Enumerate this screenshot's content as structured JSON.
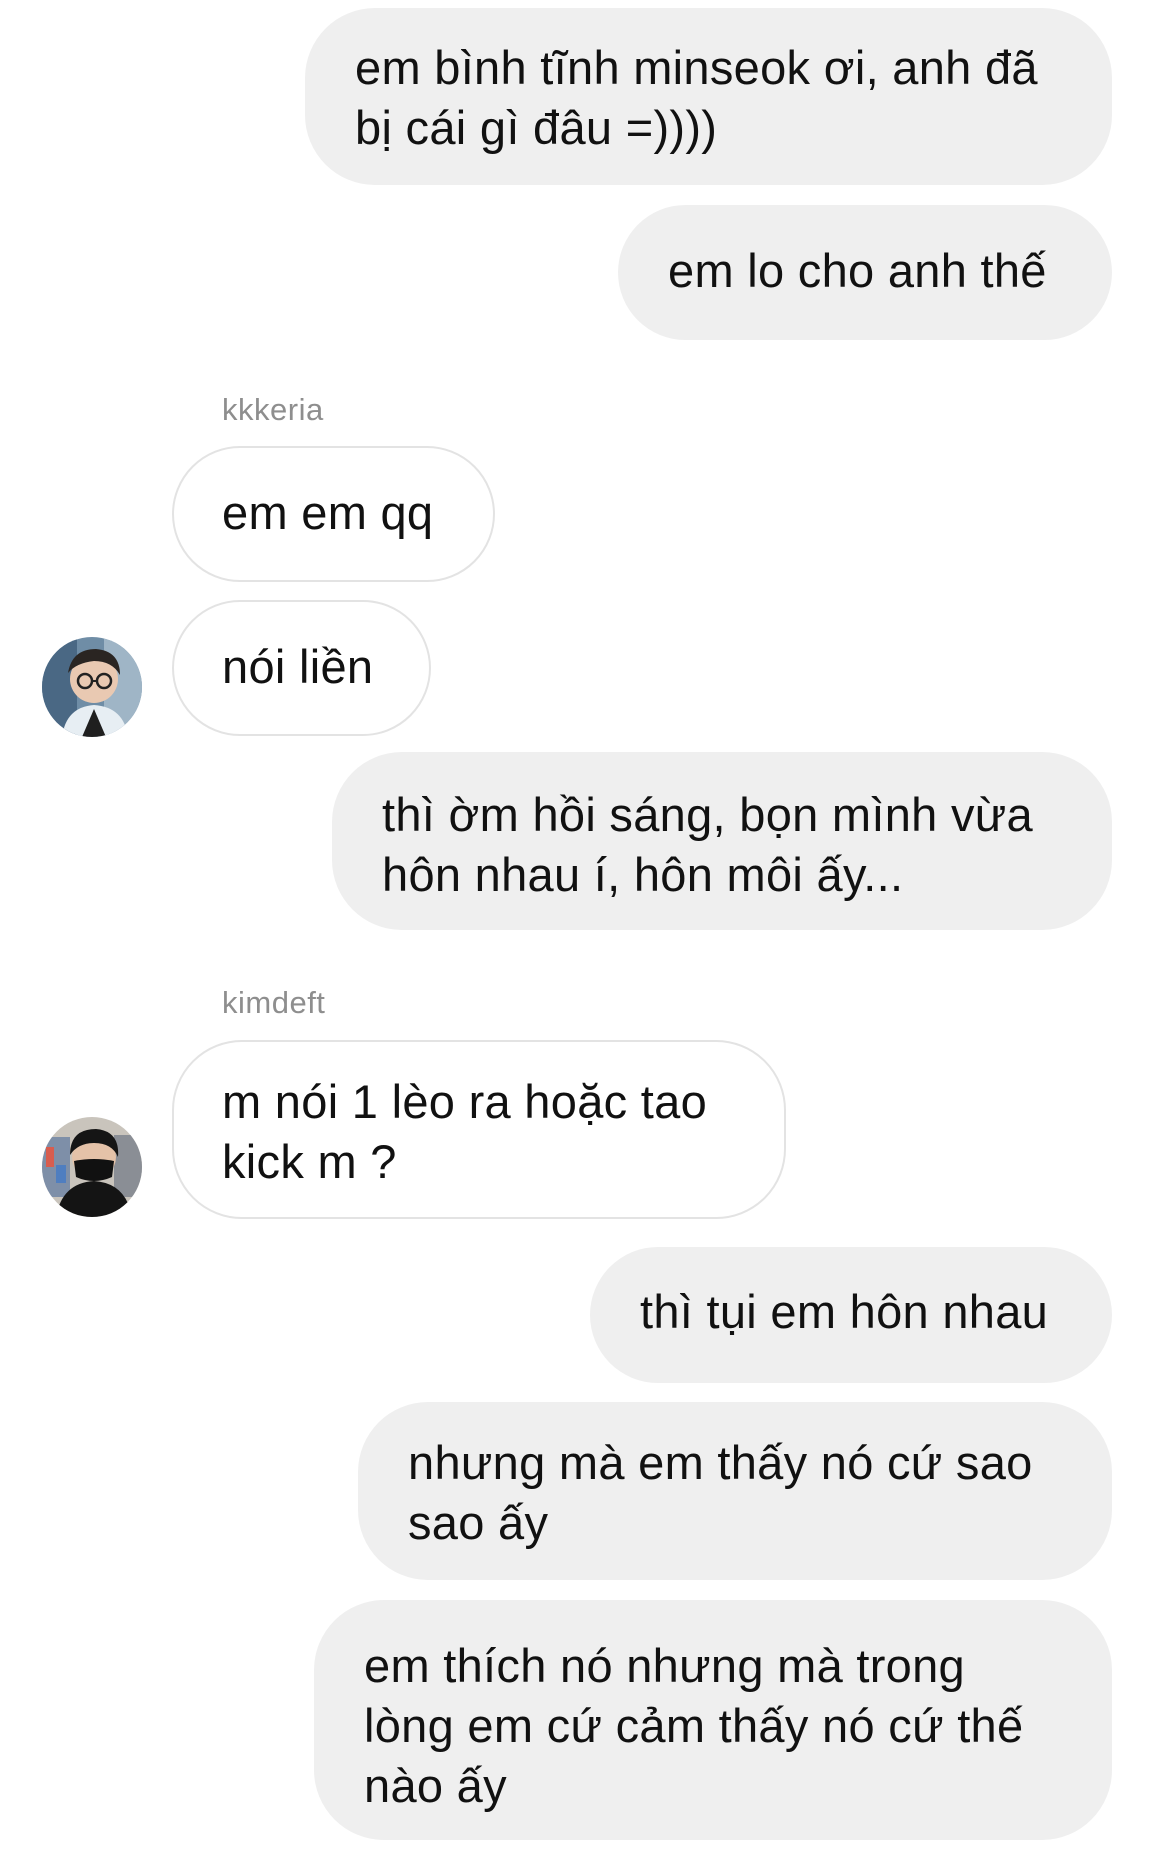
{
  "thread": {
    "messages": [
      {
        "direction": "outgoing",
        "text": "em bình tĩnh minseok ơi, anh đã\nbị cái gì đâu =))))"
      },
      {
        "direction": "outgoing",
        "text": "em lo cho anh thế"
      },
      {
        "direction": "incoming",
        "sender": "kkkeria",
        "text": "em em qq"
      },
      {
        "direction": "incoming",
        "sender": "kkkeria",
        "text": "nói liền",
        "avatar": "kkkeria-avatar"
      },
      {
        "direction": "outgoing",
        "text": "thì ờm hồi sáng, bọn mình vừa\nhôn nhau í, hôn môi ấy..."
      },
      {
        "direction": "incoming",
        "sender": "kimdeft",
        "text": "m nói 1 lèo ra hoặc tao\nkick m ?",
        "avatar": "kimdeft-avatar"
      },
      {
        "direction": "outgoing",
        "text": "thì tụi em hôn nhau"
      },
      {
        "direction": "outgoing",
        "text": "nhưng mà em thấy nó cứ sao\nsao ấy"
      },
      {
        "direction": "outgoing",
        "text": "em thích nó nhưng mà trong\nlòng em cứ cảm thấy nó cứ thế\nnào ấy"
      }
    ],
    "senders": {
      "first": "kkkeria",
      "second": "kimdeft"
    }
  },
  "colors": {
    "outgoing_bubble": "#efefef",
    "incoming_border": "#e3e3e3",
    "sender_label": "#8e8e8e",
    "text": "#111111"
  }
}
